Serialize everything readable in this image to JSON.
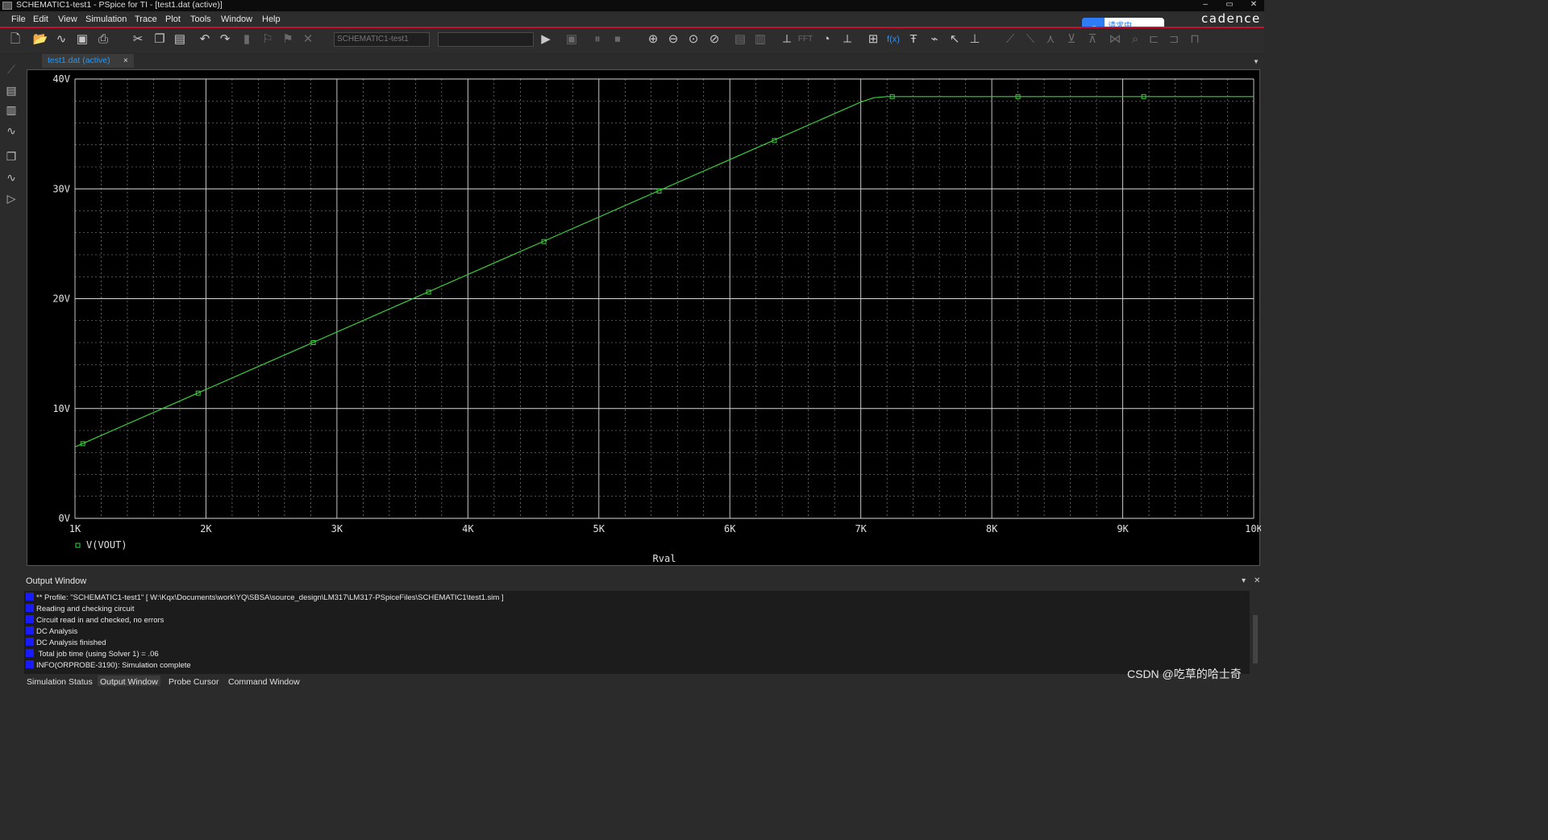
{
  "window": {
    "title": "SCHEMATIC1-test1 - PSpice for TI - [test1.dat (active)]",
    "controls": [
      "–",
      "▭",
      "✕"
    ]
  },
  "menu": [
    "File",
    "Edit",
    "View",
    "Simulation",
    "Trace",
    "Plot",
    "Tools",
    "Window",
    "Help"
  ],
  "toolbar": {
    "profile_combo": "SCHEMATIC1-test1",
    "second_combo": "",
    "fft_label": "FFT",
    "fx_label": "f(x)"
  },
  "upload_badge": {
    "text": "请求中"
  },
  "brand_logo": "cadence",
  "tab": {
    "label": "test1.dat (active)",
    "close": "×"
  },
  "chart_data": {
    "type": "line",
    "xlabel": "Rval",
    "ylabel": "",
    "xlim": [
      1000,
      10000
    ],
    "ylim": [
      0,
      40
    ],
    "x_ticks": [
      "1K",
      "2K",
      "3K",
      "4K",
      "5K",
      "6K",
      "7K",
      "8K",
      "9K",
      "10K"
    ],
    "y_ticks": [
      "0V",
      "10V",
      "20V",
      "30V",
      "40V"
    ],
    "grid": true,
    "legend": "bottom-left",
    "series": [
      {
        "name": "V(VOUT)",
        "color": "#39d03a",
        "x": [
          1000,
          7000,
          7100,
          7200,
          10000
        ],
        "y": [
          6.5,
          37.9,
          38.3,
          38.4,
          38.4
        ],
        "marker_x": [
          1060,
          1940,
          2820,
          3700,
          4580,
          5460,
          6340,
          7240,
          8200,
          9160
        ],
        "marker_y": [
          6.8,
          11.4,
          16.0,
          20.6,
          25.2,
          29.8,
          34.4,
          38.4,
          38.4,
          38.4
        ]
      }
    ]
  },
  "output_window": {
    "title": "Output Window",
    "lines": [
      "** Profile: \"SCHEMATIC1-test1\"  [ W:\\Kqx\\Documents\\work\\YQ\\SBSA\\source_design\\LM317\\LM317-PSpiceFiles\\SCHEMATIC1\\test1.sim ]",
      "Reading and checking circuit",
      "Circuit read in and checked, no errors",
      "DC Analysis",
      "DC Analysis finished",
      "  Total job time (using Solver 1)   =         .06",
      "INFO(ORPROBE-3190): Simulation complete"
    ]
  },
  "bottom_tabs": [
    "Simulation Status",
    "Output Window",
    "Probe Cursor",
    "Command Window"
  ],
  "watermark": "CSDN @吃草的哈士奇"
}
